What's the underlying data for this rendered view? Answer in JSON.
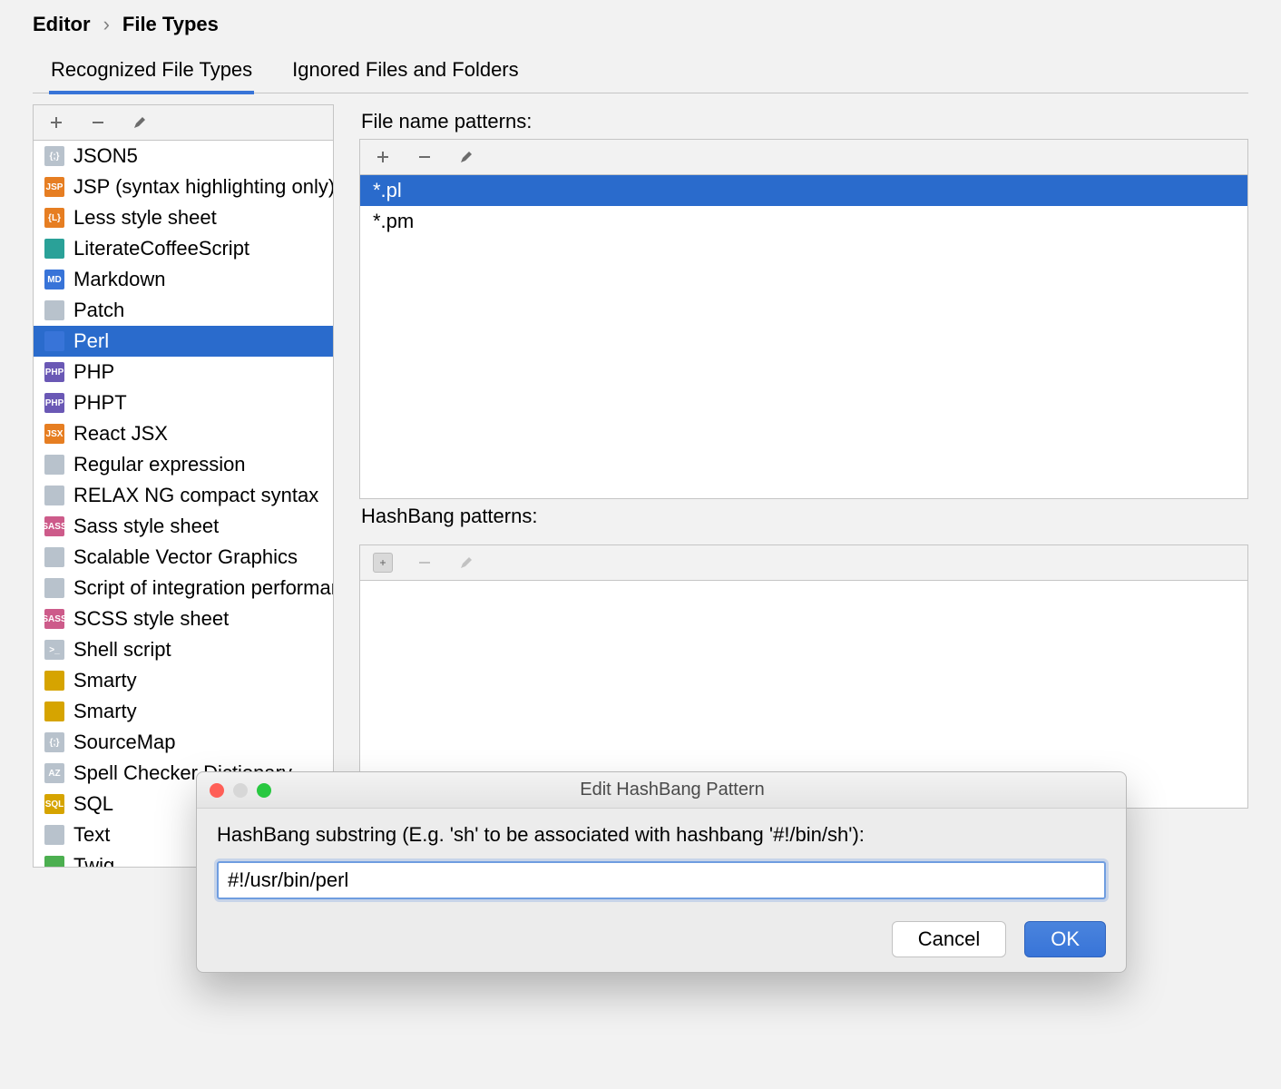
{
  "breadcrumb": {
    "parent": "Editor",
    "current": "File Types"
  },
  "tabs": [
    {
      "label": "Recognized File Types",
      "active": true
    },
    {
      "label": "Ignored Files and Folders",
      "active": false
    }
  ],
  "fileTypes": [
    {
      "label": "JSON5",
      "iconClass": "ic-generic",
      "iconText": "{;}"
    },
    {
      "label": "JSP (syntax highlighting only)",
      "iconClass": "ic-orange",
      "iconText": "JSP"
    },
    {
      "label": "Less style sheet",
      "iconClass": "ic-orange",
      "iconText": "{L}"
    },
    {
      "label": "LiterateCoffeeScript",
      "iconClass": "ic-teal",
      "iconText": ""
    },
    {
      "label": "Markdown",
      "iconClass": "ic-blue",
      "iconText": "MD"
    },
    {
      "label": "Patch",
      "iconClass": "ic-generic",
      "iconText": ""
    },
    {
      "label": "Perl",
      "iconClass": "ic-blue",
      "iconText": "",
      "selected": true
    },
    {
      "label": "PHP",
      "iconClass": "ic-purple",
      "iconText": "PHP"
    },
    {
      "label": "PHPT",
      "iconClass": "ic-purple",
      "iconText": "PHP"
    },
    {
      "label": "React JSX",
      "iconClass": "ic-orange",
      "iconText": "JSX"
    },
    {
      "label": "Regular expression",
      "iconClass": "ic-generic",
      "iconText": ""
    },
    {
      "label": "RELAX NG compact syntax",
      "iconClass": "ic-generic",
      "iconText": ""
    },
    {
      "label": "Sass style sheet",
      "iconClass": "ic-pink",
      "iconText": "SASS"
    },
    {
      "label": "Scalable Vector Graphics",
      "iconClass": "ic-generic",
      "iconText": ""
    },
    {
      "label": "Script of integration performance test",
      "iconClass": "ic-generic",
      "iconText": ""
    },
    {
      "label": "SCSS style sheet",
      "iconClass": "ic-pink",
      "iconText": "SASS"
    },
    {
      "label": "Shell script",
      "iconClass": "ic-generic",
      "iconText": ">_"
    },
    {
      "label": "Smarty",
      "iconClass": "ic-gold",
      "iconText": ""
    },
    {
      "label": "Smarty",
      "iconClass": "ic-gold",
      "iconText": ""
    },
    {
      "label": "SourceMap",
      "iconClass": "ic-generic",
      "iconText": "{;}"
    },
    {
      "label": "Spell Checker Dictionary",
      "iconClass": "ic-generic",
      "iconText": "AZ"
    },
    {
      "label": "SQL",
      "iconClass": "ic-gold",
      "iconText": "SQL"
    },
    {
      "label": "Text",
      "iconClass": "ic-generic",
      "iconText": ""
    },
    {
      "label": "Twig",
      "iconClass": "ic-green",
      "iconText": ""
    }
  ],
  "fileNamePatterns": {
    "label": "File name patterns:",
    "items": [
      {
        "label": "*.pl",
        "selected": true
      },
      {
        "label": "*.pm",
        "selected": false
      }
    ]
  },
  "hashBang": {
    "label": "HashBang patterns:"
  },
  "dialog": {
    "title": "Edit HashBang Pattern",
    "label": "HashBang substring (E.g. 'sh' to be associated with hashbang '#!/bin/sh'):",
    "value": "#!/usr/bin/perl",
    "cancel": "Cancel",
    "ok": "OK"
  }
}
